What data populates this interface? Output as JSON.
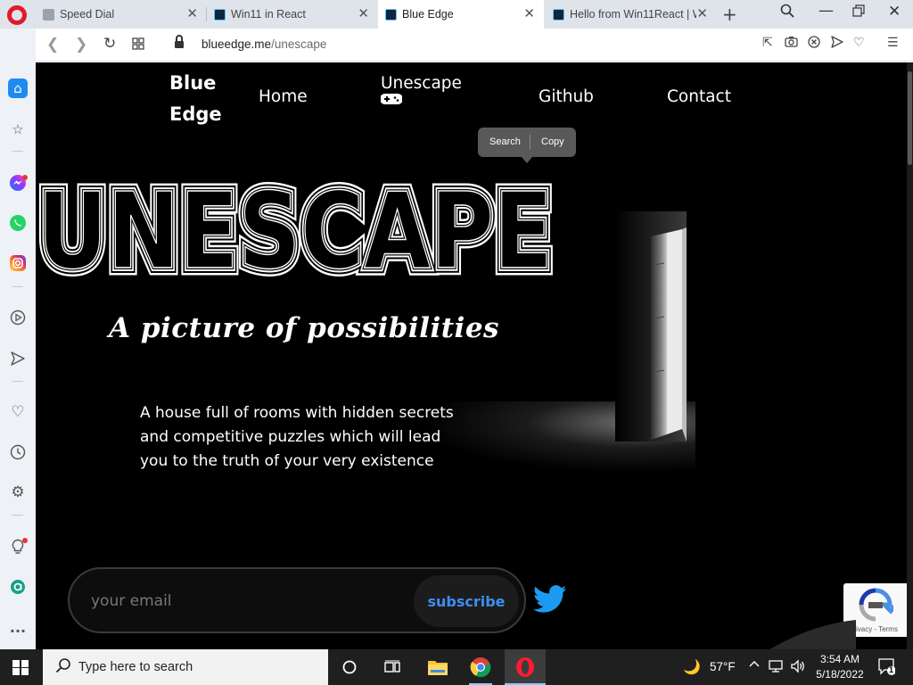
{
  "browser": {
    "tabs": [
      {
        "title": "Speed Dial",
        "active": false
      },
      {
        "title": "Win11 in React",
        "active": false
      },
      {
        "title": "Blue Edge",
        "active": true
      },
      {
        "title": "Hello from Win11React | W",
        "active": false
      }
    ],
    "new_tab_glyph": "+",
    "url": {
      "domain": "blueedge.me",
      "path": "/unescape"
    }
  },
  "site": {
    "brand_line1": "Blue",
    "brand_line2": "Edge",
    "nav": {
      "home": "Home",
      "unescape": "Unescape",
      "github": "Github",
      "contact": "Contact"
    },
    "selection_popup": {
      "search": "Search",
      "copy": "Copy"
    },
    "hero_title": "UNESCAPE",
    "tagline": "A picture of possibilities",
    "description": "A house full of rooms with hidden secrets and competitive puzzles which will lead you to the truth of your very existence",
    "email_placeholder": "your email",
    "subscribe_label": "subscribe",
    "recaptcha_terms": "Privacy - Terms"
  },
  "taskbar": {
    "search_placeholder": "Type here to search",
    "weather": "57°F",
    "time": "3:54 AM",
    "date": "5/18/2022",
    "notification_count": "1"
  },
  "colors": {
    "opera_red": "#e11a2b",
    "subscribe_blue": "#3d8ef0",
    "twitter_blue": "#1d9bf0"
  }
}
